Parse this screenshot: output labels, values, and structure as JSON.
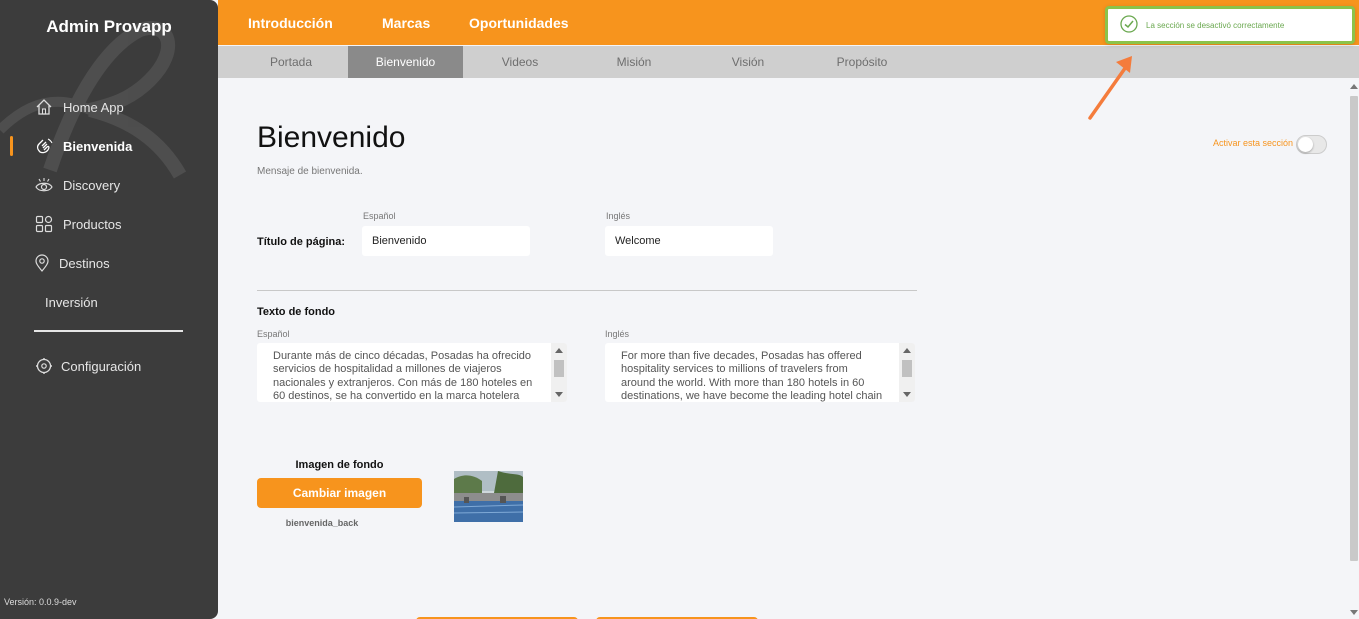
{
  "sidebar": {
    "brand": "Admin Provapp",
    "items": [
      {
        "label": "Home App",
        "icon": "home-icon"
      },
      {
        "label": "Bienvenida",
        "icon": "wave-hand-icon",
        "active": true
      },
      {
        "label": "Discovery",
        "icon": "eye-icon"
      },
      {
        "label": "Productos",
        "icon": "grid-icon"
      },
      {
        "label": "Destinos",
        "icon": "location-pin-icon"
      },
      {
        "label": "Inversión",
        "icon": ""
      }
    ],
    "config_label": "Configuración",
    "version": "Versión: 0.0.9-dev"
  },
  "topbar": {
    "tabs": [
      "Introducción",
      "Marcas",
      "Oportunidades"
    ]
  },
  "subbar": {
    "tabs": [
      "Portada",
      "Bienvenido",
      "Videos",
      "Misión",
      "Visión",
      "Propósito"
    ],
    "active": "Bienvenido"
  },
  "toast": {
    "message": "La sección se desactivó correctamente"
  },
  "main": {
    "title": "Bienvenido",
    "subtitle": "Mensaje de bienvenida.",
    "toggle_label": "Activar esta sección",
    "page_title_field": {
      "label": "Título de página:",
      "lang_es": "Español",
      "lang_en": "Inglés",
      "value_es": "Bienvenido",
      "value_en": "Welcome"
    },
    "background_text": {
      "label": "Texto de fondo",
      "lang_es": "Español",
      "lang_en": "Inglés",
      "value_es": "Durante más de cinco décadas, Posadas ha ofrecido servicios de hospitalidad a millones de viajeros nacionales y extranjeros. Con más de 180 hoteles en 60 destinos, se ha convertido en la marca hotelera",
      "value_en": "For more than five decades, Posadas has offered hospitality services to millions of travelers from around the world. With more than 180 hotels in 60 destinations, we have become the leading hotel chain"
    },
    "background_image": {
      "label": "Imagen de fondo",
      "button": "Cambiar imagen",
      "file_name": "bienvenida_back"
    }
  },
  "colors": {
    "accent": "#f7941d",
    "sidebar": "#3c3c3c",
    "success": "#8bc34a"
  }
}
